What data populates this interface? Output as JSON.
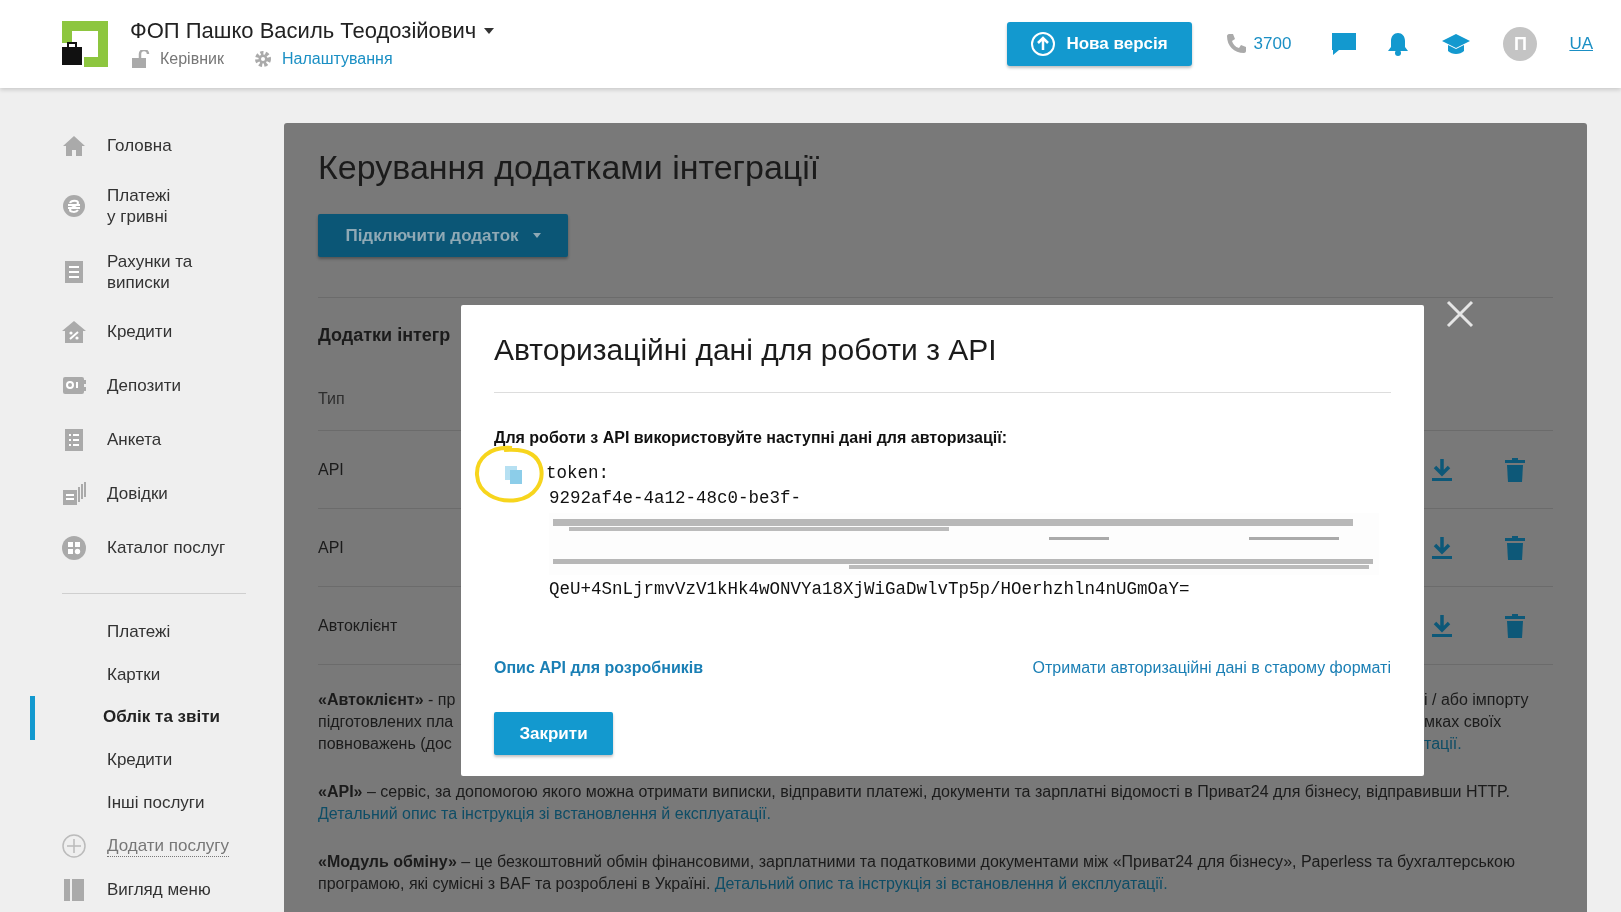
{
  "header": {
    "user_name": "ФОП Пашко Василь Теодозійович",
    "role": "Керівник",
    "settings_link": "Налаштування",
    "new_version_button": "Нова версія",
    "phone": "3700",
    "avatar_initial": "П",
    "language": "UA"
  },
  "sidebar": {
    "items": [
      {
        "label": "Головна"
      },
      {
        "label": "Платежі\nу гривні"
      },
      {
        "label": "Рахунки та\nвиписки"
      },
      {
        "label": "Кредити"
      },
      {
        "label": "Депозити"
      },
      {
        "label": "Анкета"
      },
      {
        "label": "Довідки"
      },
      {
        "label": "Каталог послуг"
      }
    ],
    "sub_items": [
      {
        "label": "Платежі",
        "selected": false
      },
      {
        "label": "Картки",
        "selected": false
      },
      {
        "label": "Облік та звіти",
        "selected": true
      },
      {
        "label": "Кредити",
        "selected": false
      },
      {
        "label": "Інші послуги",
        "selected": false
      }
    ],
    "add_service": "Додати послугу",
    "menu_view": "Вигляд меню"
  },
  "main": {
    "title": "Керування додатками інтеграції",
    "connect_button": "Підключити додаток",
    "section_title": "Додатки інтегр",
    "column_label": "Тип",
    "rows": [
      {
        "type": "API"
      },
      {
        "type": "API"
      },
      {
        "type": "Автоклієнт"
      }
    ],
    "paragraph_1_left": [
      "**«Автоклієнт»** - пр",
      "підготовлених пла",
      "повноважень (дос"
    ],
    "paragraph_1_right": [
      {
        "text": "і / або імпорту",
        "kind": "text"
      },
      {
        "text": "мках своїх",
        "kind": "text"
      },
      {
        "text": "тації.",
        "kind": "link"
      }
    ],
    "paragraphs": [
      {
        "text": "**«API»** – сервіс, за допомогою якого можна отримати виписки, відправити платежі, документи та зарплатні відомості в Приват24 для бізнесу, відправивши HTTP.",
        "link": "Детальний опис та інструкція зі встановлення й експлуатації."
      },
      {
        "text": "**«Модуль обміну»** – це безкоштовний обмін фінансовими, зарплатними та податковими документами між «Приват24 для бізнесу», Paperless та бухгалтерською програмою, які сумісні з BAF та розроблені в Україні.",
        "link": "Детальний опис та інструкція зі встановлення й експлуатації."
      }
    ]
  },
  "modal": {
    "title": "Авторизаційні дані для роботи з API",
    "instruction": "Для роботи з API використовуйте наступні дані для авторизації:",
    "token_label": "token:",
    "token_start": "9292af4e-4a12-48c0-be3f-",
    "token_end": "QeU+4SnLjrmvVzV1kHk4wONVYa18XjWiGaDwlvTp5p/HOerhzhln4nUGmOaY=",
    "docs_link": "Опис API для розробників",
    "old_format_link": "Отримати авторизаційні дані в старому форматі",
    "close_button": "Закрити"
  }
}
